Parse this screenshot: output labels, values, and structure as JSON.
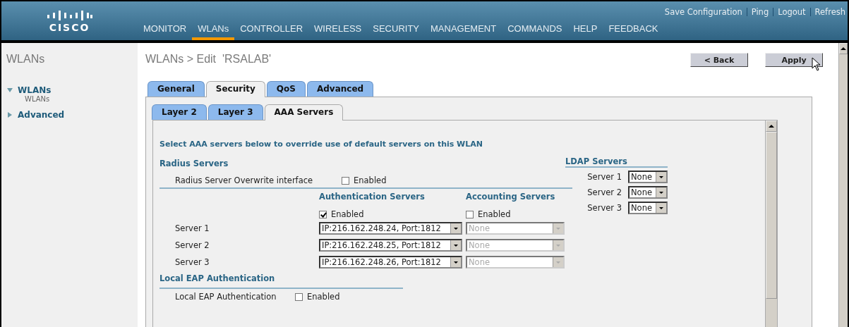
{
  "header": {
    "logo": "CISCO",
    "links": [
      "Save Configuration",
      "Ping",
      "Logout",
      "Refresh"
    ],
    "nav": [
      {
        "label": "MONITOR",
        "selected": false
      },
      {
        "label": "WLANs",
        "selected": true
      },
      {
        "label": "CONTROLLER",
        "selected": false
      },
      {
        "label": "WIRELESS",
        "selected": false
      },
      {
        "label": "SECURITY",
        "selected": false
      },
      {
        "label": "MANAGEMENT",
        "selected": false
      },
      {
        "label": "COMMANDS",
        "selected": false
      },
      {
        "label": "HELP",
        "selected": false
      },
      {
        "label": "FEEDBACK",
        "selected": false
      }
    ]
  },
  "sidebar": {
    "title": "WLANs",
    "items": [
      {
        "label": "WLANs",
        "expanded": true,
        "children": [
          {
            "label": "WLANs"
          }
        ]
      },
      {
        "label": "Advanced",
        "expanded": false
      }
    ]
  },
  "page_title": "WLANs > Edit  'RSALAB'",
  "buttons": [
    "< Back",
    "Apply"
  ],
  "tabs": [
    {
      "label": "General",
      "selected": false
    },
    {
      "label": "Security",
      "selected": true
    },
    {
      "label": "QoS",
      "selected": false
    },
    {
      "label": "Advanced",
      "selected": false
    }
  ],
  "subtabs": [
    {
      "label": "Layer 2",
      "selected": false
    },
    {
      "label": "Layer 3",
      "selected": false
    },
    {
      "label": "AAA Servers",
      "selected": true
    }
  ],
  "intro": "Select AAA servers below to override use of default servers on this WLAN",
  "radius": {
    "heading": "Radius Servers",
    "overwrite": {
      "label": "Radius Server Overwrite interface",
      "checked": false,
      "option": "Enabled"
    },
    "auth_heading": "Authentication Servers",
    "acct_heading": "Accounting Servers",
    "auth_enabled": {
      "checked": true,
      "option": "Enabled"
    },
    "acct_enabled": {
      "checked": false,
      "option": "Enabled"
    },
    "servers": [
      {
        "label": "Server 1",
        "auth": "IP:216.162.248.24, Port:1812",
        "acct": "None",
        "acct_disabled": true
      },
      {
        "label": "Server 2",
        "auth": "IP:216.162.248.25, Port:1812",
        "acct": "None",
        "acct_disabled": true
      },
      {
        "label": "Server 3",
        "auth": "IP:216.162.248.26, Port:1812",
        "acct": "None",
        "acct_disabled": true
      }
    ]
  },
  "local_eap": {
    "heading": "Local EAP Authentication",
    "label": "Local EAP Authentication",
    "checked": false,
    "option": "Enabled"
  },
  "ldap": {
    "heading": "LDAP Servers",
    "servers": [
      {
        "label": "Server 1",
        "value": "None"
      },
      {
        "label": "Server 2",
        "value": "None"
      },
      {
        "label": "Server 3",
        "value": "None"
      }
    ]
  }
}
